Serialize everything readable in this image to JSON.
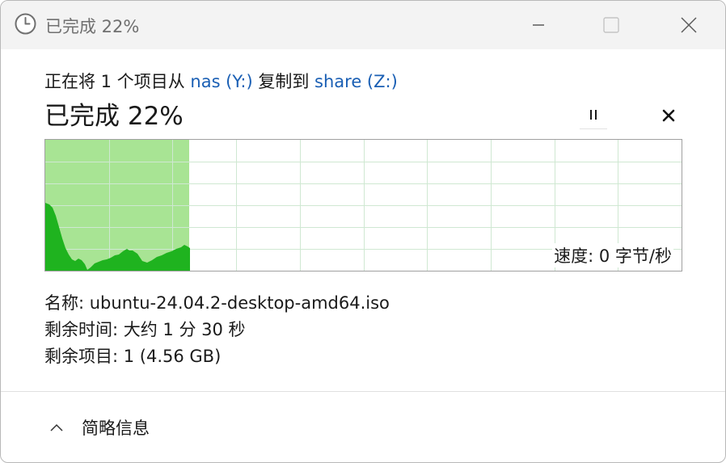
{
  "window": {
    "title": "已完成 22%"
  },
  "transfer": {
    "prefix": "正在将 1 个项目从 ",
    "source": "nas (Y:)",
    "middle": " 复制到 ",
    "destination": "share (Z:)",
    "status": "已完成 22%",
    "progress_fraction": 0.22,
    "speed": "速度: 0 字节/秒"
  },
  "details": {
    "name": "名称: ubuntu-24.04.2-desktop-amd64.iso",
    "time_remaining": "剩余时间: 大约 1 分 30 秒",
    "items_remaining": "剩余项目: 1 (4.56 GB)"
  },
  "footer": {
    "toggle_label": "简略信息"
  },
  "colors": {
    "progress_fill": "#a8e494",
    "throughput_fill": "#1fb31f",
    "grid_line": "#cfe8d2",
    "link": "#1a5fb4"
  }
}
